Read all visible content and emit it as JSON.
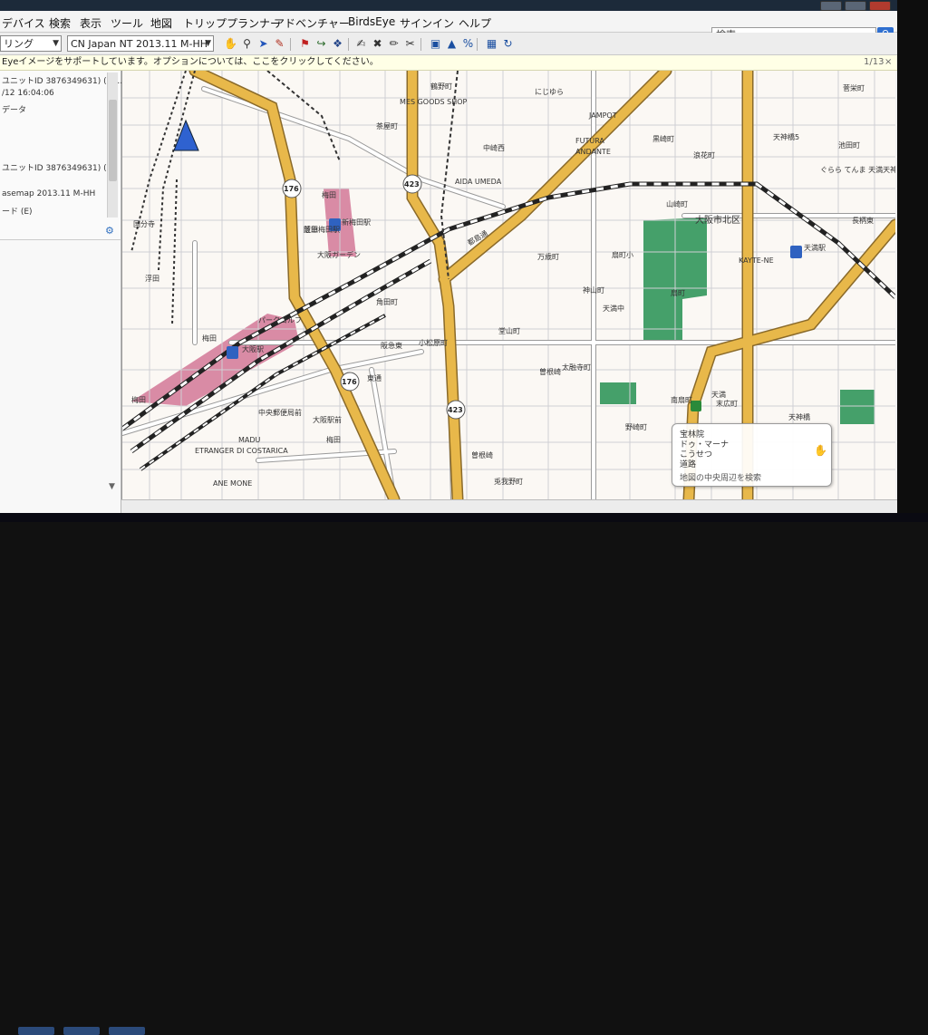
{
  "menu": {
    "items": [
      "デバイス",
      "検索",
      "表示",
      "ツール",
      "地図",
      "トリッププランナー",
      "アドベンチャー",
      "BirdsEye",
      "サインイン",
      "ヘルプ"
    ],
    "search_placeholder": "検索"
  },
  "toolbar": {
    "mode_value": "リング",
    "map_product_value": "CN Japan NT 2013.11 M-HH"
  },
  "infobar": {
    "message": "Eyeイメージをサポートしています。オプションについては、ここをクリックしてください。",
    "page": "1/13",
    "close": "×"
  },
  "sidebar": {
    "lines": [
      "ユニットID 3876349631) (F)…",
      "/12 16:04:06",
      "データ",
      "ユニットID 3876349631) (F)",
      "asemap 2013.11 M-HH",
      "ード (E)"
    ]
  },
  "map": {
    "place_labels": [
      "梅田",
      "芝田",
      "中崎西",
      "茶屋町",
      "鶴野町",
      "天神橋5",
      "池田町",
      "黒崎町",
      "浪花町",
      "山崎町",
      "大阪市北区",
      "万歳町",
      "扇町小",
      "扇町",
      "神山町",
      "天満中",
      "天満",
      "堂山町",
      "小松原町",
      "阪急東",
      "曽根崎",
      "太融寺町",
      "兎我野町",
      "角田町",
      "東通",
      "梅田",
      "大阪駅前",
      "中央郵便局前",
      "梅田",
      "野崎町",
      "南扇町",
      "末広町",
      "天神橋",
      "曽根崎",
      "国分寺",
      "菅栄町",
      "長柄東",
      "浮田",
      "天満駅",
      "新梅田駅",
      "阪急梅田駅",
      "大阪駅",
      "梅田",
      "大阪ガーデン",
      "ぐらら てんま 天満天神橋",
      "MES GOODS SHOP",
      "にじゆら",
      "JAMPOT",
      "FUTURA",
      "ANDANTE",
      "AIDA UMEDA",
      "KAYTE-NE",
      "MADU",
      "ETRANGER DI COSTARICA",
      "ANE MONE",
      "パークゴルフ"
    ],
    "route_shields": [
      "176",
      "423",
      "176",
      "423"
    ],
    "railway_label": "都島通"
  },
  "popup": {
    "lines": [
      "宝林院",
      "ドゥ・マーナ",
      "こうせつ",
      "道路",
      "地図の中央周辺を検索"
    ]
  }
}
